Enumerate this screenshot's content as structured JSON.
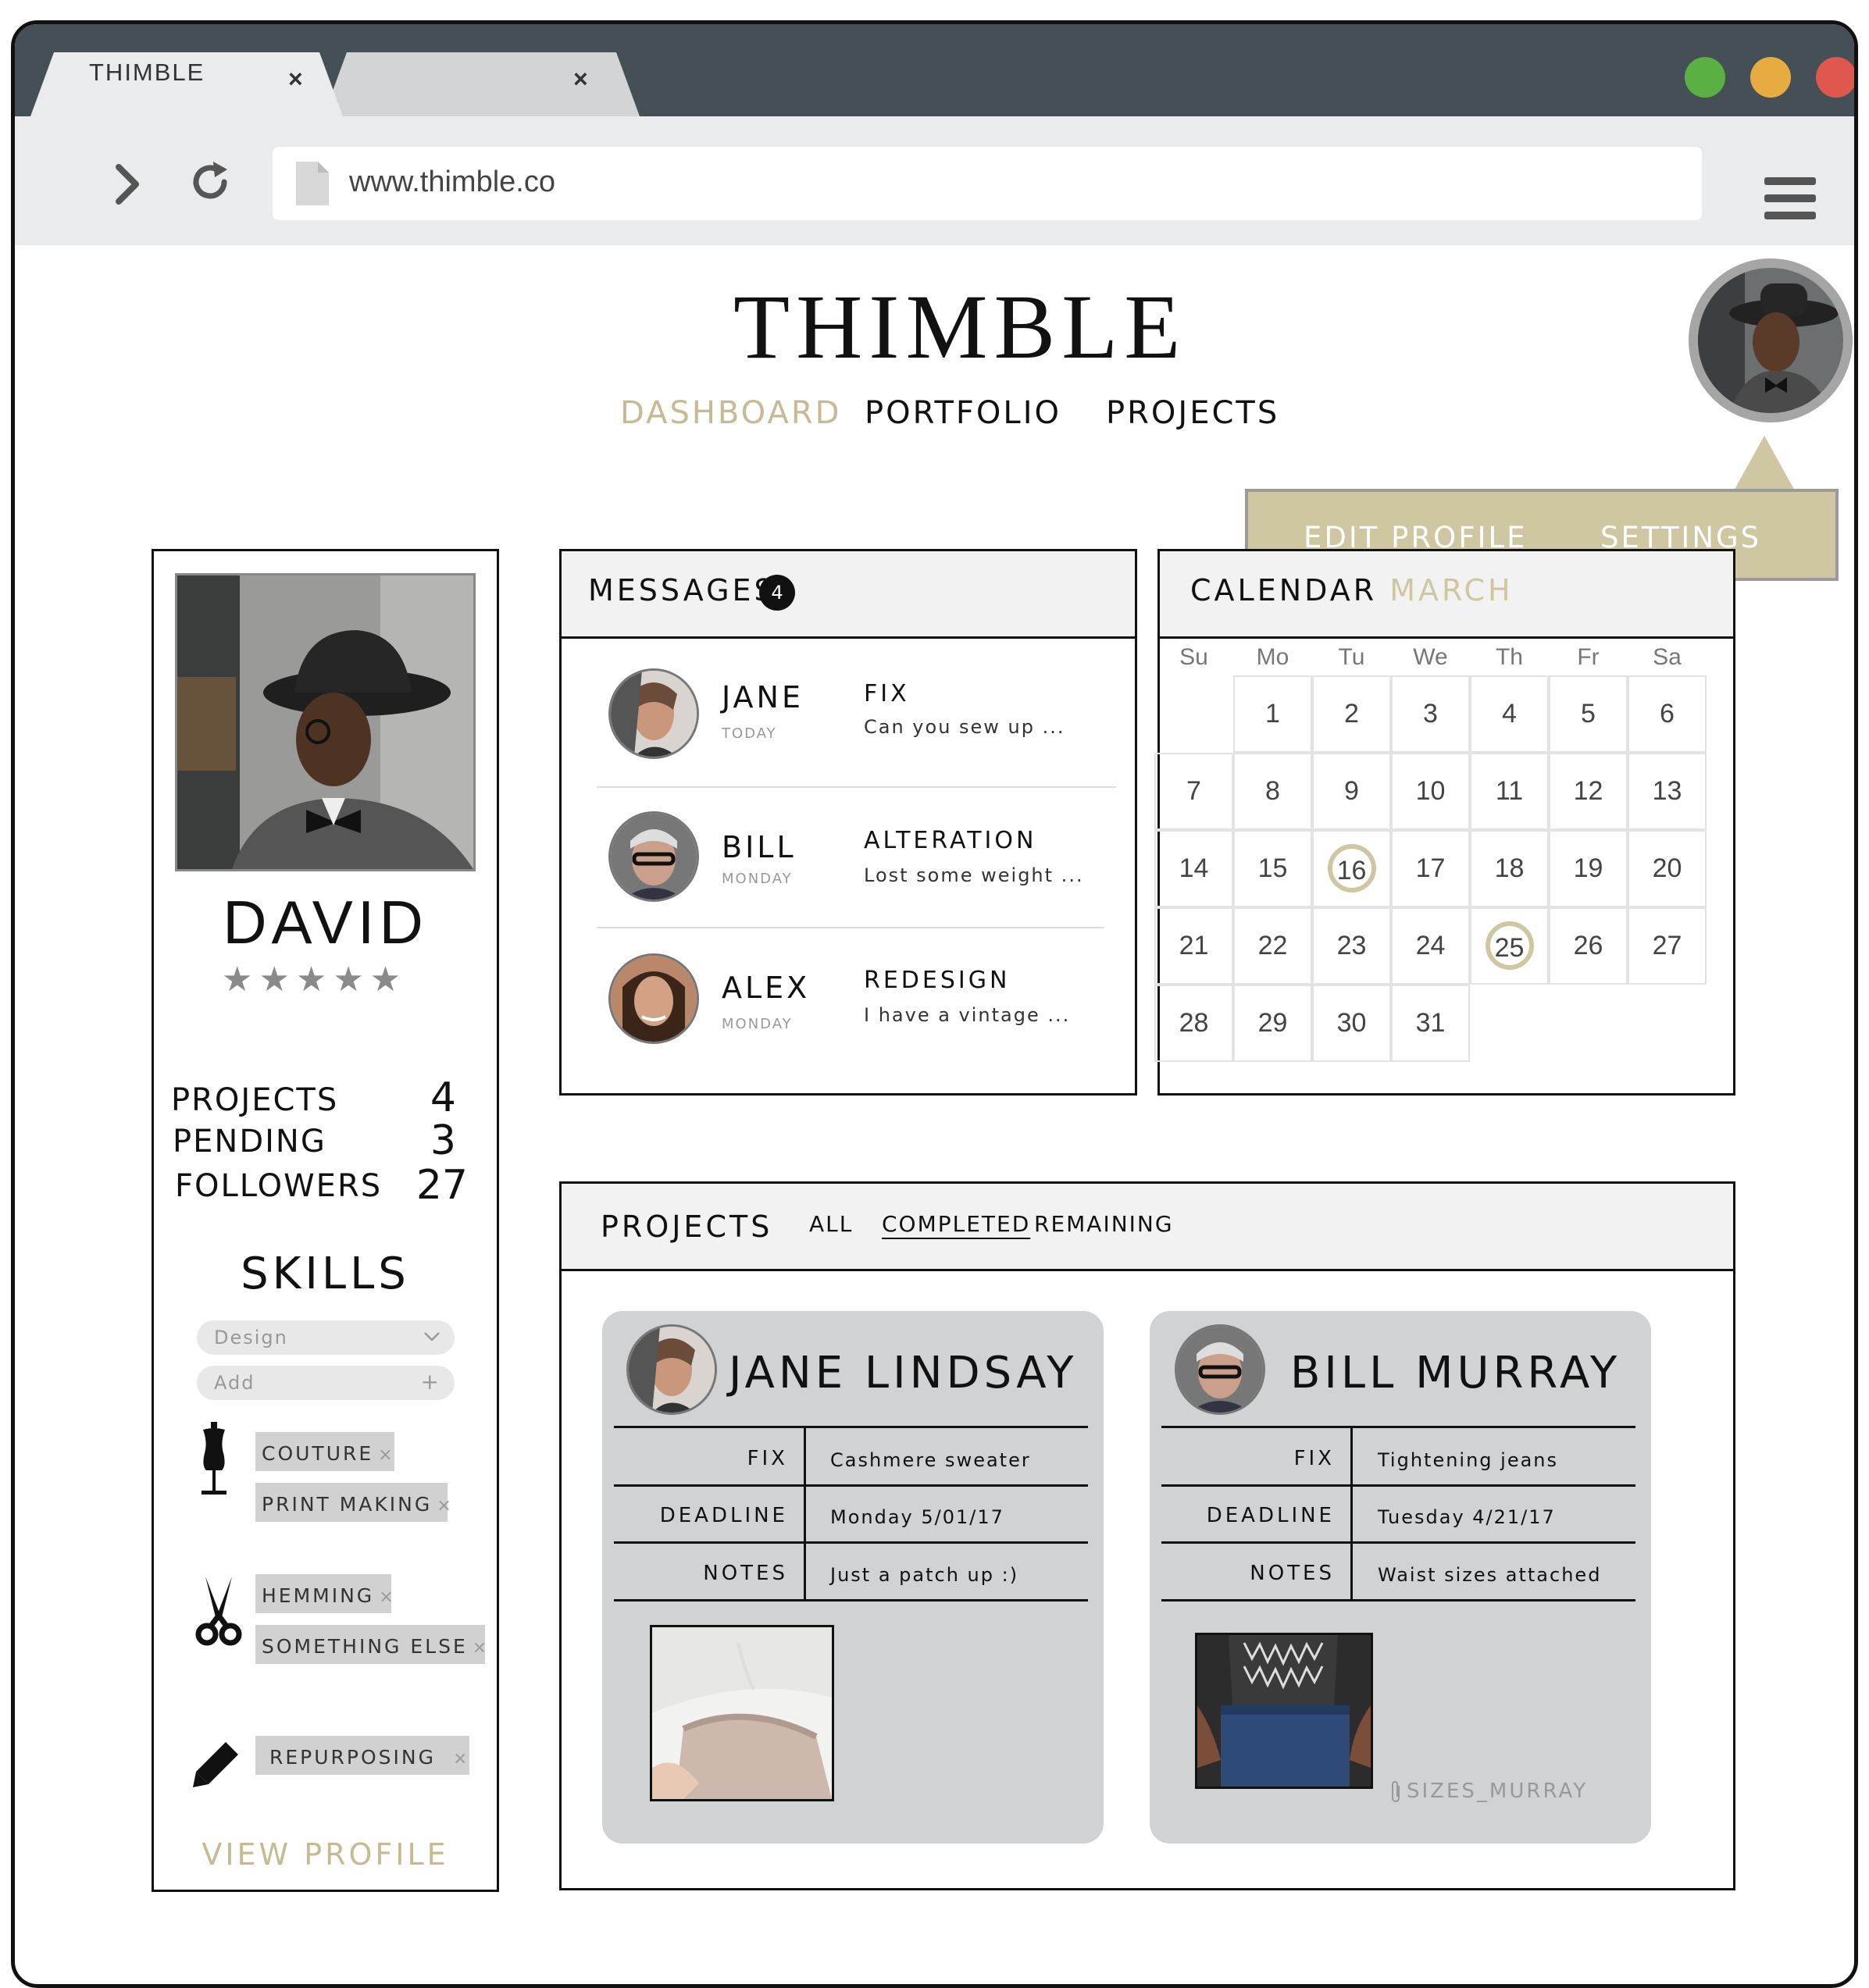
{
  "browser": {
    "tabs": [
      {
        "title": "THIMBLE",
        "close": "×"
      },
      {
        "title": "",
        "close": "×"
      }
    ],
    "url": "www.thimble.co",
    "window_buttons": {
      "green": "#5bb044",
      "yellow": "#e6ac42",
      "red": "#e0574e"
    }
  },
  "header": {
    "logo": "THIMBLE",
    "nav": [
      "DASHBOARD",
      "PORTFOLIO",
      "PROJECTS"
    ],
    "active_nav": "DASHBOARD",
    "accent_color": "#c7b991",
    "menu": {
      "edit_profile": "EDIT PROFILE",
      "settings": "SETTINGS"
    }
  },
  "profile": {
    "name": "DAVID",
    "rating": 5,
    "stars": "★★★★★",
    "stats": [
      {
        "label": "PROJECTS",
        "value": "4"
      },
      {
        "label": "PENDING",
        "value": "3"
      },
      {
        "label": "FOLLOWERS",
        "value": "27"
      }
    ],
    "skills_title": "SKILLS",
    "select_placeholder": "Design",
    "add_placeholder": "Add",
    "skill_groups": [
      {
        "icon": "dress-form-icon",
        "tags": [
          "COUTURE",
          "PRINT MAKING"
        ]
      },
      {
        "icon": "scissors-icon",
        "tags": [
          "HEMMING",
          "SOMETHING ELSE"
        ]
      },
      {
        "icon": "pencil-icon",
        "tags": [
          "REPURPOSING"
        ]
      }
    ],
    "tag_remove": "×",
    "view_profile": "VIEW PROFILE"
  },
  "messages": {
    "title": "MESSAGES",
    "count": "4",
    "items": [
      {
        "name": "JANE",
        "day": "TODAY",
        "subject": "FIX",
        "preview": "Can you sew up ..."
      },
      {
        "name": "BILL",
        "day": "MONDAY",
        "subject": "ALTERATION",
        "preview": "Lost some weight ..."
      },
      {
        "name": "ALEX",
        "day": "MONDAY",
        "subject": "REDESIGN",
        "preview": "I have a vintage ..."
      }
    ]
  },
  "calendar": {
    "title": "CALENDAR",
    "month": "MARCH",
    "weekdays": [
      "Su",
      "Mo",
      "Tu",
      "We",
      "Th",
      "Fr",
      "Sa"
    ],
    "first_weekday": 1,
    "days": 31,
    "marked": [
      16,
      25
    ]
  },
  "projects": {
    "title": "PROJECTS",
    "tabs": [
      "ALL",
      "COMPLETED",
      "REMAINING"
    ],
    "active_tab": "COMPLETED",
    "row_labels": [
      "FIX",
      "DEADLINE",
      "NOTES"
    ],
    "cards": [
      {
        "client": "JANE LINDSAY",
        "fix": "Cashmere sweater",
        "deadline": "Monday 5/01/17",
        "notes": "Just a patch up :)"
      },
      {
        "client": "BILL MURRAY",
        "fix": "Tightening jeans",
        "deadline": "Tuesday 4/21/17",
        "notes": "Waist sizes attached",
        "attachment": "SIZES_MURRAY"
      }
    ]
  }
}
